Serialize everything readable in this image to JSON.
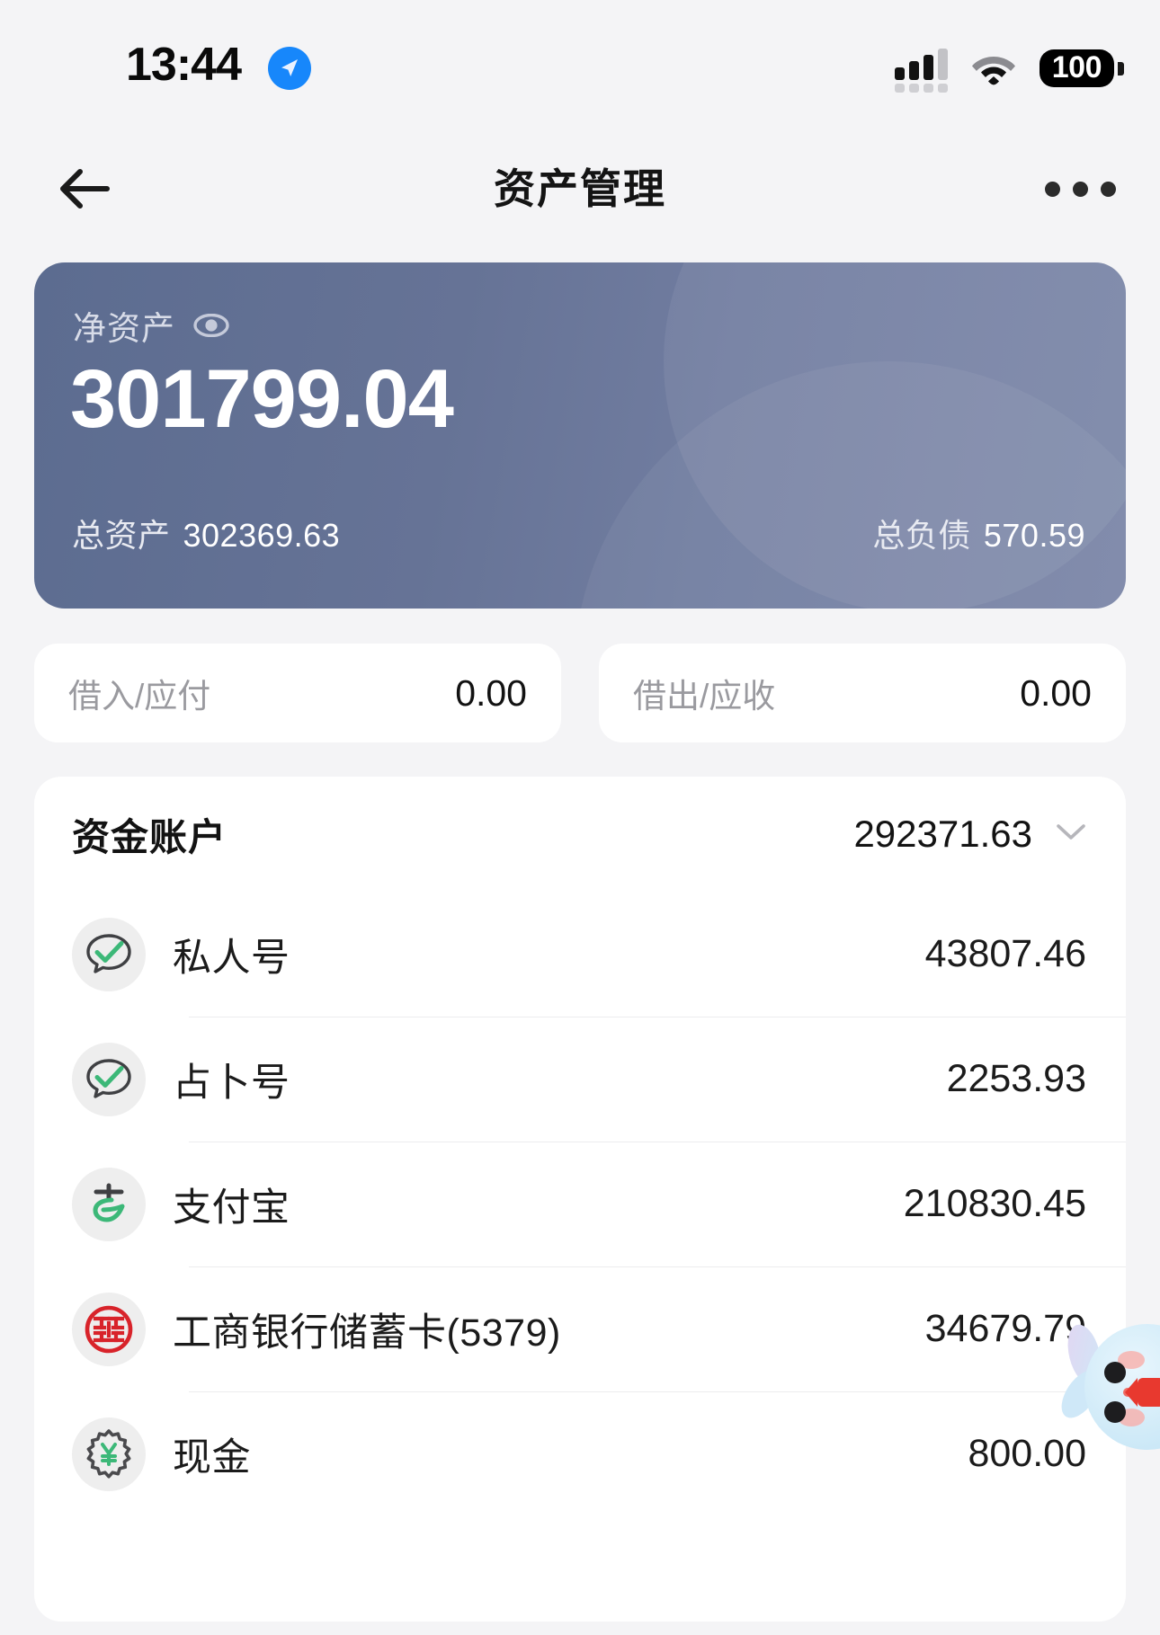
{
  "statusbar": {
    "time": "13:44",
    "location_icon": "location-arrow-icon",
    "cellular_icon": "cellular-signal-icon",
    "wifi_icon": "wifi-icon",
    "battery_level": "100"
  },
  "navbar": {
    "back_icon": "back-arrow-icon",
    "title": "资产管理",
    "more_icon": "more-options-icon"
  },
  "hero": {
    "net_label": "净资产",
    "eye_icon": "eye-icon",
    "net_amount": "301799.04",
    "total_assets_label": "总资产",
    "total_assets_value": "302369.63",
    "total_liabilities_label": "总负债",
    "total_liabilities_value": "570.59",
    "gradient_from": "#5c6c90",
    "gradient_to": "#7b86a8"
  },
  "mini_cards": [
    {
      "label": "借入/应付",
      "value": "0.00"
    },
    {
      "label": "借出/应收",
      "value": "0.00"
    }
  ],
  "accounts_panel": {
    "title": "资金账户",
    "total": "292371.63",
    "chevron_icon": "chevron-down-icon",
    "rows": [
      {
        "icon": "wechat-pay-icon",
        "name": "私人号",
        "balance": "43807.46"
      },
      {
        "icon": "wechat-pay-icon",
        "name": "占卜号",
        "balance": "2253.93"
      },
      {
        "icon": "alipay-icon",
        "name": "支付宝",
        "balance": "210830.45"
      },
      {
        "icon": "icbc-bank-icon",
        "name": "工商银行储蓄卡(5379)",
        "balance": "34679.79"
      },
      {
        "icon": "cash-yuan-icon",
        "name": "现金",
        "balance": "800.00"
      }
    ]
  },
  "decoration": {
    "sticker_icon": "bunny-mascot-sticker"
  },
  "colors": {
    "page_bg": "#f4f4f6",
    "card_bg": "#ffffff",
    "text_primary": "#1b1b1b",
    "text_muted": "#9a9a9f",
    "accent_green": "#3cb878",
    "accent_red": "#d8232a",
    "accent_blue": "#1787fb"
  }
}
